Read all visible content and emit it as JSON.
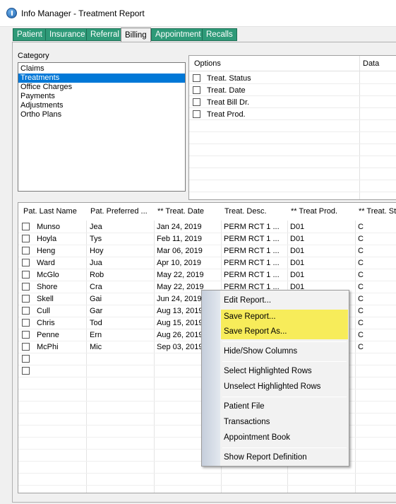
{
  "window": {
    "title": "Info Manager - Treatment Report"
  },
  "tabs": [
    "Patient",
    "Insurance",
    "Referral",
    "Billing",
    "Appointment",
    "Recalls"
  ],
  "category": {
    "label": "Category",
    "items": [
      "Claims",
      "Treatments",
      "Office Charges",
      "Payments",
      "Adjustments",
      "Ortho Plans"
    ],
    "selected": "Treatments"
  },
  "options": {
    "col_options": "Options",
    "col_data": "Data",
    "items": [
      "Treat. Status",
      "Treat. Date",
      "Treat Bill Dr.",
      "Treat Prod."
    ]
  },
  "grid": {
    "columns": [
      "Pat. Last Name",
      "Pat. Preferred ...",
      "** Treat. Date",
      "Treat. Desc.",
      "** Treat Prod.",
      "** Treat. St"
    ],
    "rows": [
      [
        "Munso",
        "Jea",
        "Jan 24, 2019",
        "PERM RCT 1 ...",
        "D01",
        "C"
      ],
      [
        "Hoyla",
        "Tys",
        "Feb 11, 2019",
        "PERM RCT 1 ...",
        "D01",
        "C"
      ],
      [
        "Heng",
        "Hoy",
        "Mar 06, 2019",
        "PERM RCT 1 ...",
        "D01",
        "C"
      ],
      [
        "Ward",
        "Jua",
        "Apr 10, 2019",
        "PERM RCT 1 ...",
        "D01",
        "C"
      ],
      [
        "McGlo",
        "Rob",
        "May 22, 2019",
        "PERM RCT 1 ...",
        "D01",
        "C"
      ],
      [
        "Shore",
        "Cra",
        "May 22, 2019",
        "PERM RCT 1 ...",
        "D01",
        "C"
      ],
      [
        "Skell",
        "Gai",
        "Jun 24, 2019",
        "",
        "",
        "C"
      ],
      [
        "Cull",
        "Gar",
        "Aug 13, 2019",
        "",
        "",
        "C"
      ],
      [
        "Chris",
        "Tod",
        "Aug 15, 2019",
        "",
        "",
        "C"
      ],
      [
        "Penne",
        "Ern",
        "Aug 26, 2019",
        "",
        "",
        "C"
      ],
      [
        "McPhi",
        "Mic",
        "Sep 03, 2019",
        "",
        "",
        "C"
      ],
      [
        "",
        "",
        "",
        "",
        "",
        ""
      ],
      [
        "",
        "",
        "",
        "",
        "",
        ""
      ]
    ]
  },
  "context_menu": {
    "items": [
      "Edit Report...",
      "Save Report...",
      "Save Report As...",
      "Hide/Show Columns",
      "Select Highlighted Rows",
      "Unselect Highlighted Rows",
      "Patient File",
      "Transactions",
      "Appointment Book",
      "Show Report Definition"
    ],
    "highlight_color": "#f7ec5a"
  }
}
